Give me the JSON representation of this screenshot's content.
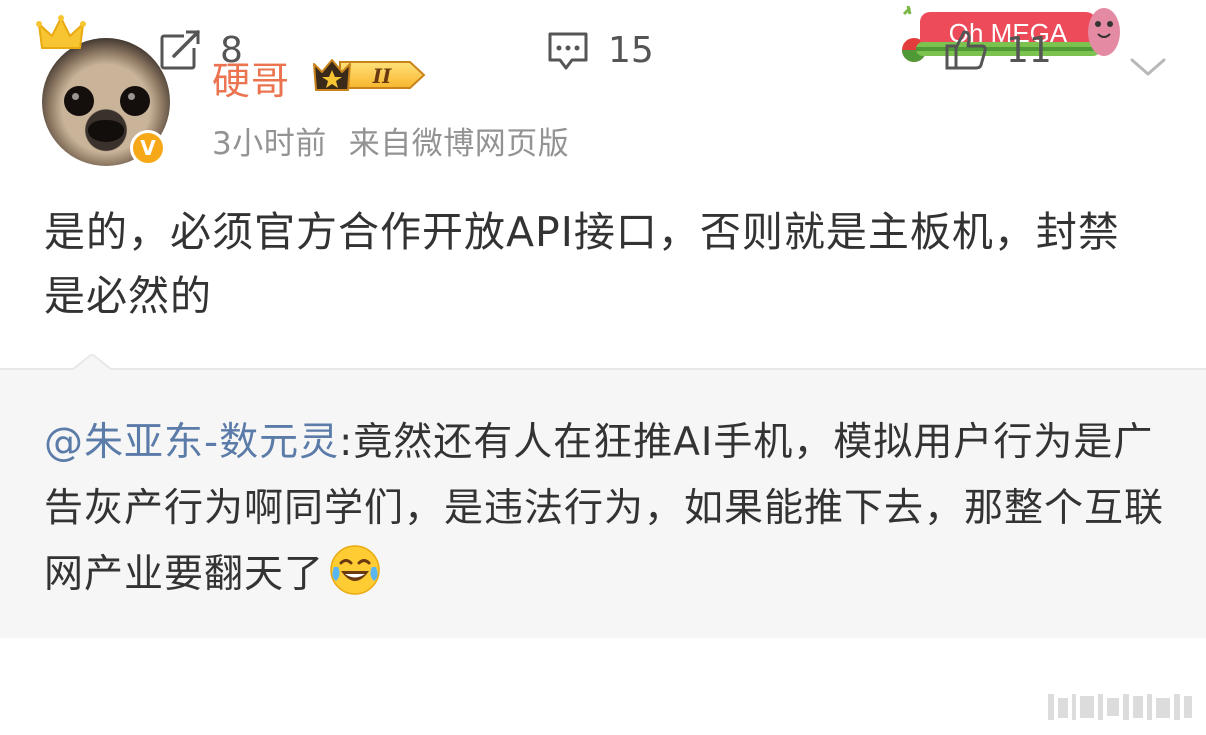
{
  "user": {
    "name": "硬哥",
    "level_badge": "II",
    "vip_badge": "V",
    "time": "3小时前",
    "source": "来自微博网页版"
  },
  "sticker": {
    "text": "Oh MEGA"
  },
  "post": {
    "text": "是的，必须官方合作开放API接口，否则就是主板机，封禁是必然的"
  },
  "repost": {
    "mention": "@朱亚东-数元灵",
    "text": ":竟然还有人在狂推AI手机，模拟用户行为是广告灰产行为啊同学们，是违法行为，如果能推下去，那整个互联网产业要翻天了"
  },
  "actions": {
    "repost_count": "8",
    "comment_count": "15",
    "like_count": "11"
  },
  "colors": {
    "username": "#eb7350",
    "mention": "#5b7ba8",
    "meta": "#939393",
    "repost_bg": "#f6f6f6"
  }
}
